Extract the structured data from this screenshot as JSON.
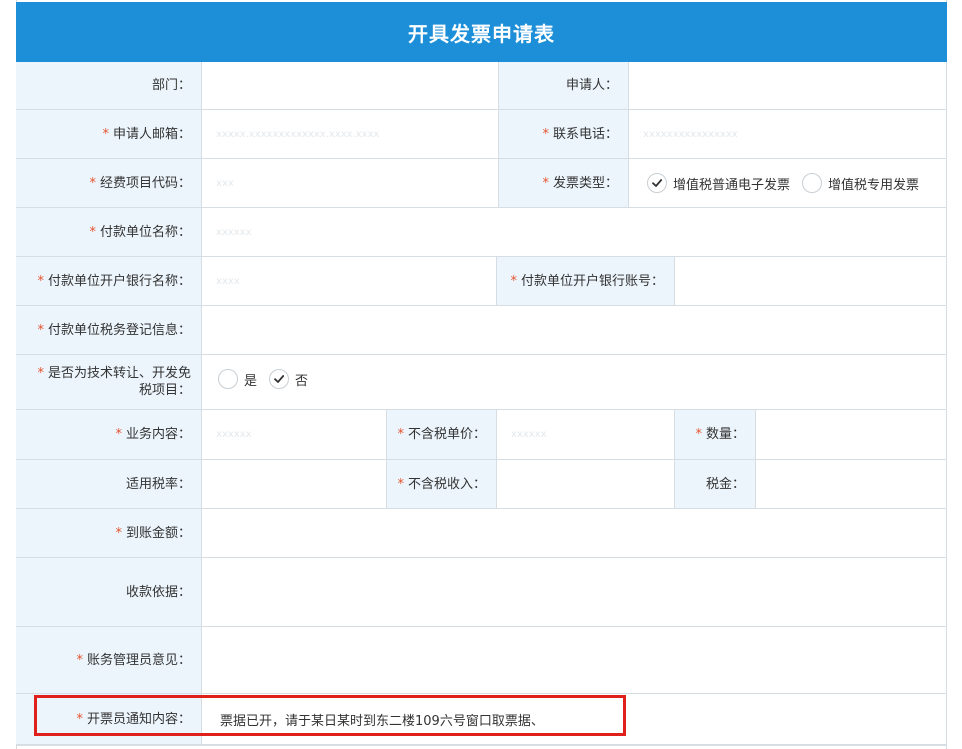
{
  "form": {
    "title": "开具发票申请表",
    "required_mark": "*",
    "fields": {
      "department": {
        "label": "部门："
      },
      "applicant": {
        "label": "申请人："
      },
      "applicant_email": {
        "label": "申请人邮箱：",
        "value": "xxxxx.xxxxxxxxxxxxx.xxxx.xxxx"
      },
      "contact_phone": {
        "label": "联系电话：",
        "value": "xxxxxxxxxxxxxxxx"
      },
      "funding_code": {
        "label": "经费项目代码：",
        "value": "xxx"
      },
      "invoice_type": {
        "label": "发票类型：",
        "options": [
          "增值税普通电子发票",
          "增值税专用发票"
        ],
        "selected": "增值税普通电子发票"
      },
      "payer_name": {
        "label": "付款单位名称：",
        "value": "xxxxxx"
      },
      "payer_bank_name": {
        "label": "付款单位开户银行名称：",
        "value": "xxxx"
      },
      "payer_bank_account": {
        "label": "付款单位开户银行账号：",
        "value": ""
      },
      "payer_tax_info": {
        "label": "付款单位税务登记信息：",
        "value": ""
      },
      "tech_transfer_exempt": {
        "label_line1": "是否为技术转让、开发免",
        "label_line2": "税项目：",
        "options": [
          "是",
          "否"
        ],
        "selected": "否"
      },
      "business_content": {
        "label": "业务内容：",
        "value": "xxxxxx"
      },
      "unit_price_ex_tax": {
        "label": "不含税单价：",
        "value": "xxxxxx"
      },
      "quantity": {
        "label": "数量：",
        "value": ""
      },
      "tax_rate": {
        "label": "适用税率：",
        "value": ""
      },
      "revenue_ex_tax": {
        "label": "不含税收入：",
        "value": ""
      },
      "tax_amount": {
        "label": "税金：",
        "value": ""
      },
      "received_amount": {
        "label": "到账金额：",
        "value": ""
      },
      "payment_basis": {
        "label": "收款依据：",
        "value": ""
      },
      "finance_manager_opinion": {
        "label": "账务管理员意见：",
        "value": ""
      },
      "issuer_notice": {
        "label": "开票员通知内容：",
        "value": "票据已开，请于某日某时到东二楼109六号窗口取票据、"
      }
    }
  },
  "colors": {
    "header_bg": "#1c8fd8",
    "label_bg": "#ecf5fc",
    "required": "#e5532f",
    "highlight": "#e0201b"
  }
}
